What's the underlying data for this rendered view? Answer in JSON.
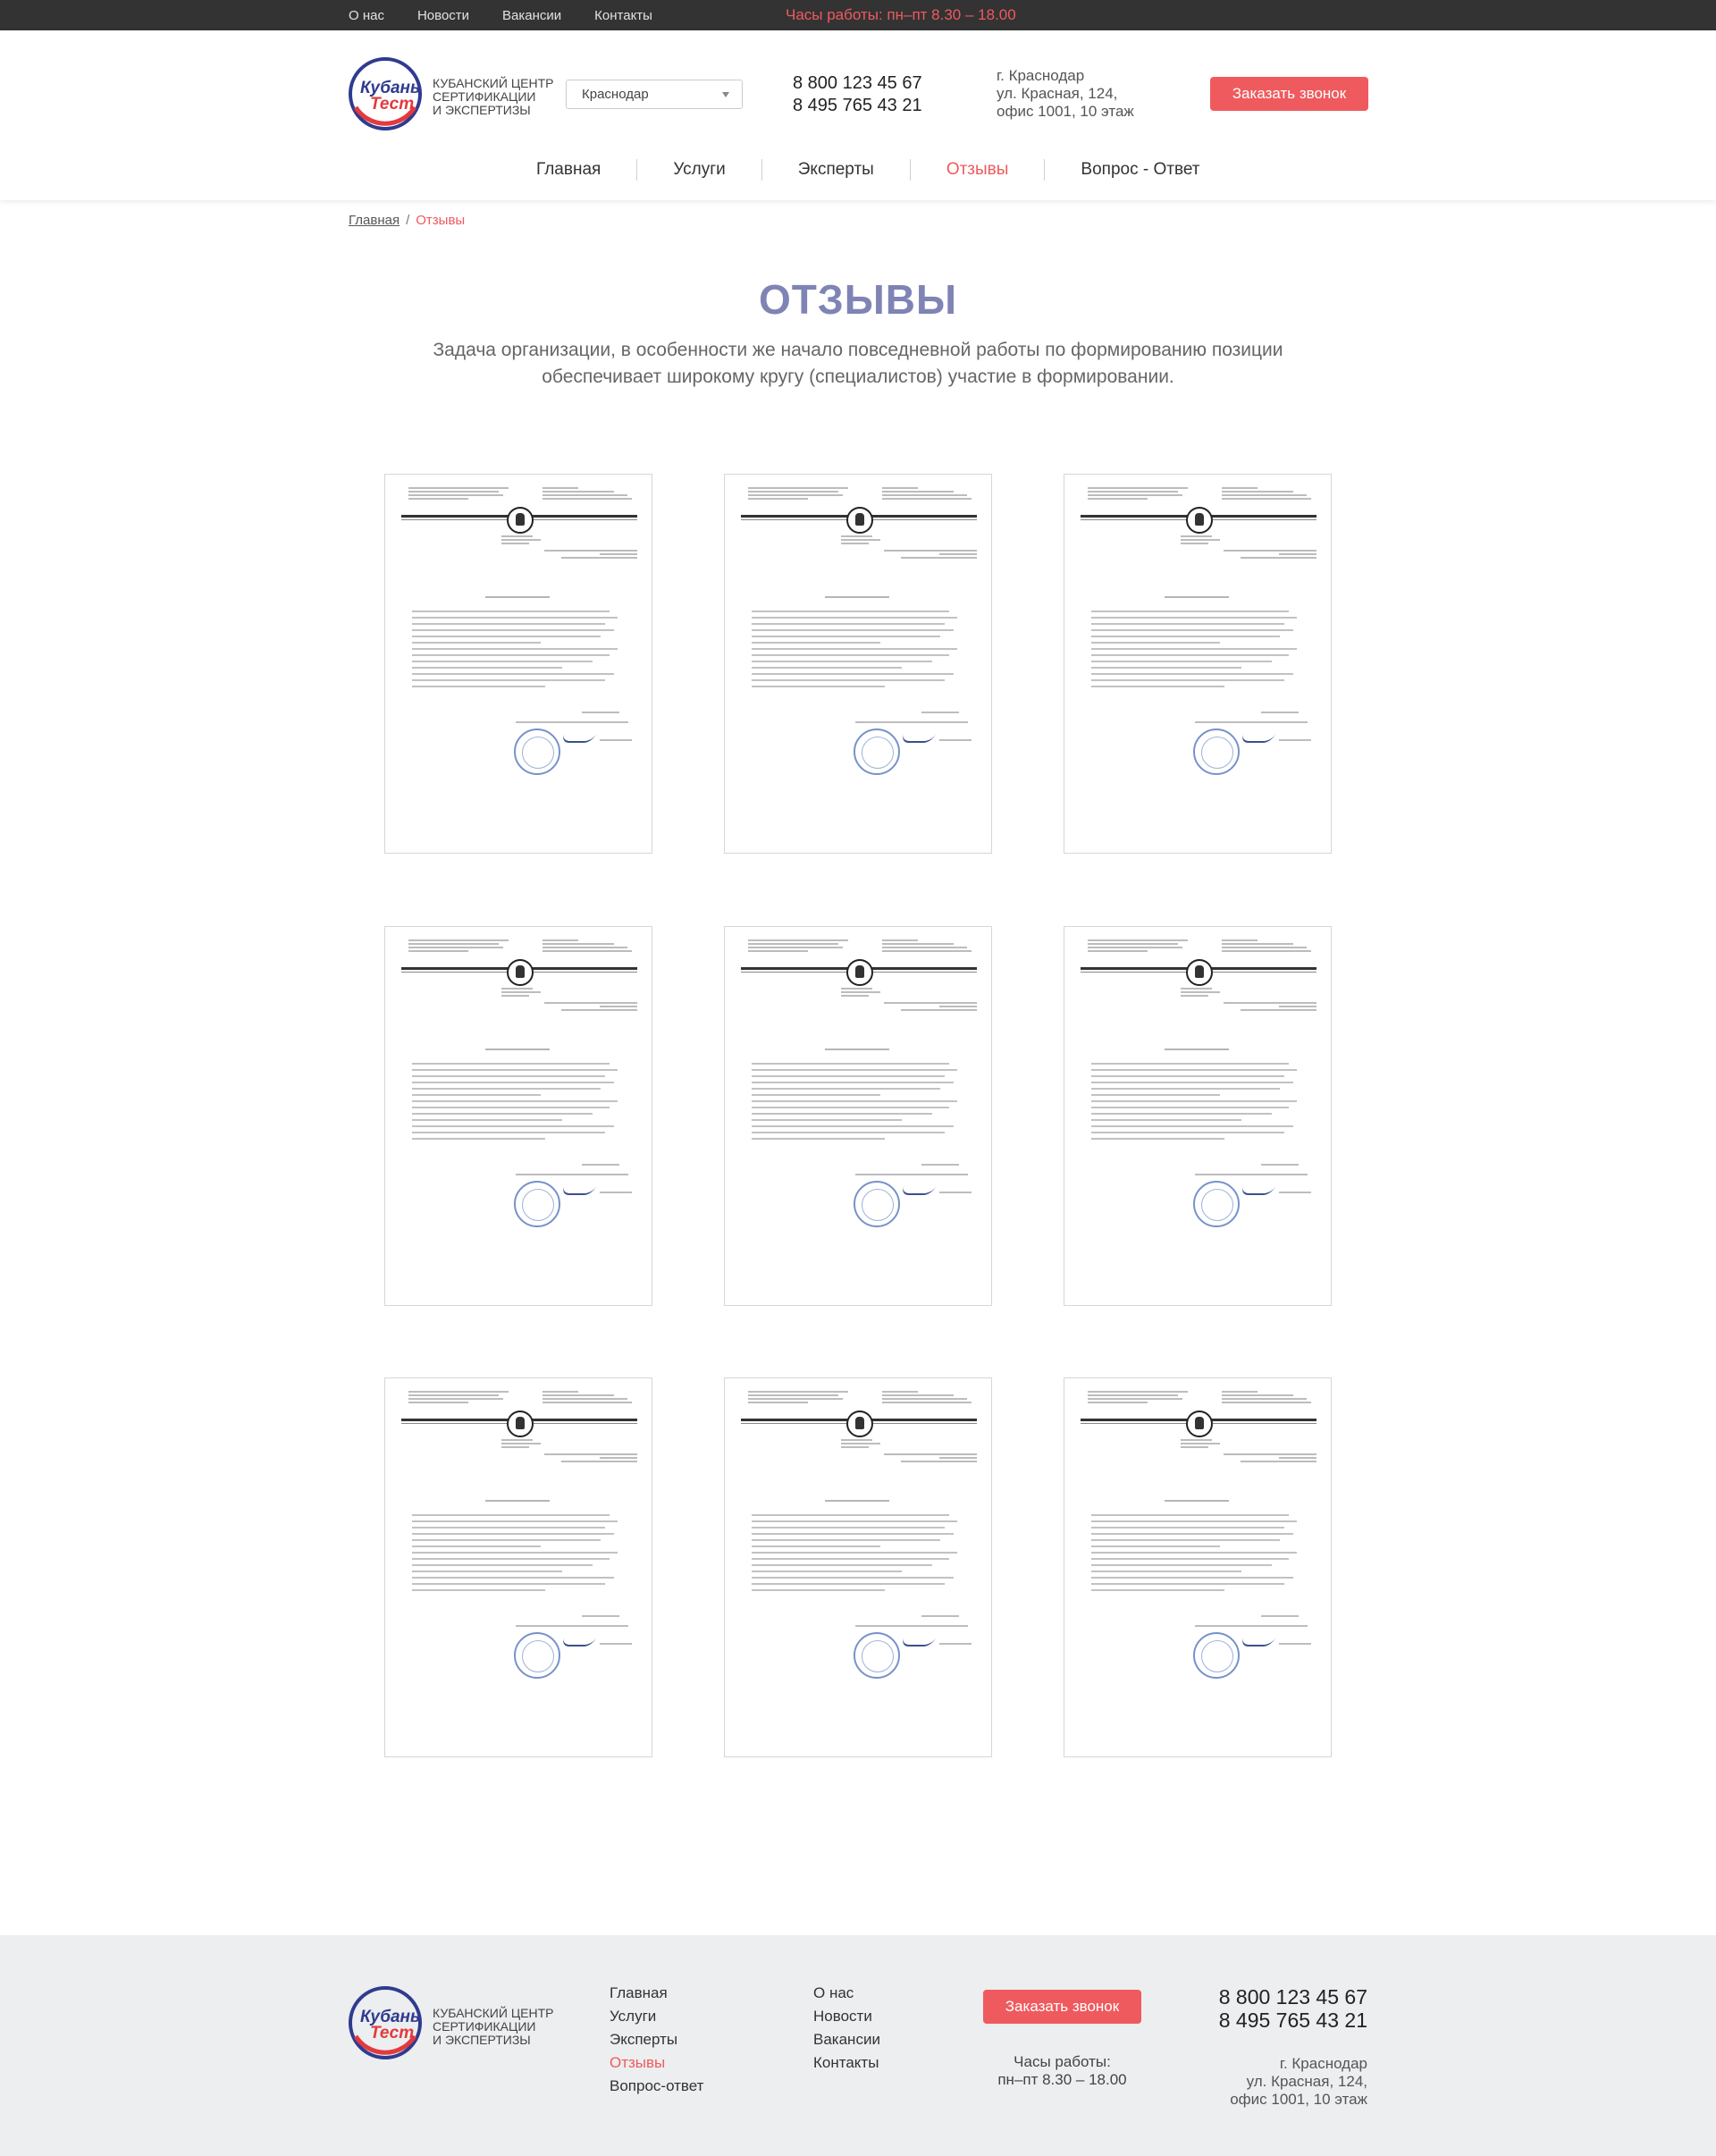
{
  "topbar": {
    "nav": [
      "О нас",
      "Новости",
      "Вакансии",
      "Контакты"
    ],
    "hours": "Часы работы: пн–пт 8.30 – 18.00"
  },
  "header": {
    "logo_alt": "Кубань Тест",
    "logo_lines": [
      "Кубанский центр",
      "сертификации",
      "и экспертизы"
    ],
    "city": "Краснодар",
    "phones": [
      "8 800 123 45 67",
      "8 495 765 43 21"
    ],
    "address_lines": [
      "г. Краснодар",
      "ул. Красная, 124,",
      "офис 1001, 10 этаж"
    ],
    "call_button": "Заказать звонок",
    "nav": [
      {
        "label": "Главная",
        "active": false
      },
      {
        "label": "Услуги",
        "active": false
      },
      {
        "label": "Эксперты",
        "active": false
      },
      {
        "label": "Отзывы",
        "active": true
      },
      {
        "label": "Вопрос - Ответ",
        "active": false
      }
    ]
  },
  "breadcrumb": {
    "home": "Главная",
    "separator": "/",
    "current": "Отзывы"
  },
  "main": {
    "title": "ОТЗЫВЫ",
    "subtitle": "Задача организации, в особенности же начало повседневной работы по формированию позиции обеспечивает широкому кругу (специалистов) участие в формировании.",
    "reviews_count": 9
  },
  "footer": {
    "logo_lines": [
      "Кубанский центр",
      "сертификации",
      "и экспертизы"
    ],
    "col1": [
      {
        "label": "Главная",
        "active": false
      },
      {
        "label": "Услуги",
        "active": false
      },
      {
        "label": "Эксперты",
        "active": false
      },
      {
        "label": "Отзывы",
        "active": true
      },
      {
        "label": "Вопрос-ответ",
        "active": false
      }
    ],
    "col2": [
      "О нас",
      "Новости",
      "Вакансии",
      "Контакты"
    ],
    "call_button": "Заказать звонок",
    "hours_lines": [
      "Часы работы:",
      "пн–пт 8.30 – 18.00"
    ],
    "phones": [
      "8 800 123 45 67",
      "8 495 765 43 21"
    ],
    "address_lines": [
      "г. Краснодар",
      "ул. Красная, 124,",
      "офис 1001, 10 этаж"
    ]
  },
  "colors": {
    "accent": "#ef5a5e",
    "title": "#7f84b5",
    "topbar": "#333333",
    "footer_bg": "#eceeef"
  }
}
